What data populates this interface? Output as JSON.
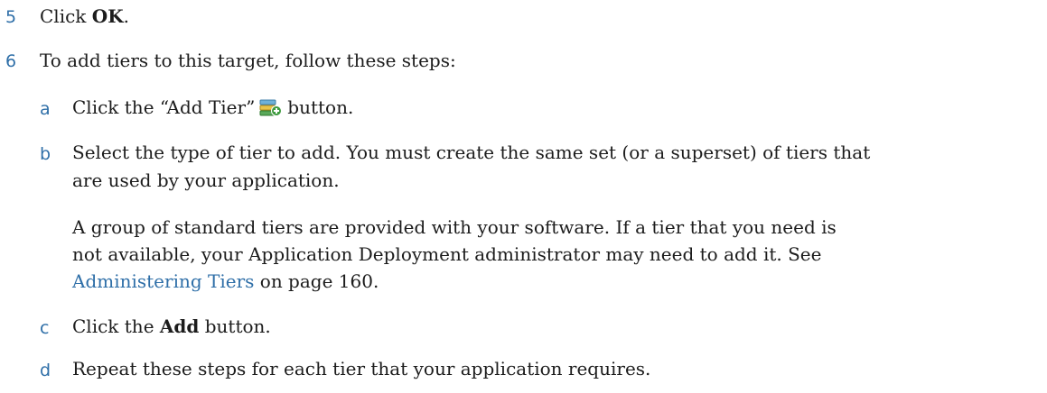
{
  "steps": [
    {
      "num": "5",
      "pre": "Click ",
      "bold": "OK",
      "post": "."
    },
    {
      "num": "6",
      "text": "To add tiers to this target, follow these steps:"
    }
  ],
  "substeps": {
    "a": {
      "letter": "a",
      "pre": "Click the “Add Tier”",
      "icon": "add-tier-icon",
      "post": "button."
    },
    "b": {
      "letter": "b",
      "line1": "Select the type of tier to add. You must create the same set (or a superset) of tiers that",
      "line2": "are used by your application.",
      "para_line1": "A group of standard tiers are provided with your software. If a tier that you need is",
      "para_line2": "not available, your Application Deployment administrator may need to add it. See",
      "link": "Administering Tiers",
      "after_link": " on page 160."
    },
    "c": {
      "letter": "c",
      "pre": "Click the ",
      "bold": "Add",
      "post": " button."
    },
    "d": {
      "letter": "d",
      "text": "Repeat these steps for each tier that your application requires."
    }
  },
  "colors": {
    "number": "#2f6fa8",
    "link": "#2f6fa8"
  }
}
